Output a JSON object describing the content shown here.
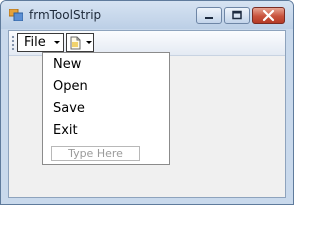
{
  "window": {
    "title": "frmToolStrip",
    "icons": {
      "app": "form-icon",
      "minimize": "minimize-icon",
      "maximize": "maximize-icon",
      "close": "close-icon"
    }
  },
  "toolstrip": {
    "file_menu": {
      "label": "File",
      "icon": "chevron-down-icon"
    },
    "new_item_split": {
      "icon": "new-document-icon",
      "arrow": "chevron-down-icon"
    }
  },
  "file_dropdown": {
    "items": [
      {
        "label": "New"
      },
      {
        "label": "Open"
      },
      {
        "label": "Save"
      },
      {
        "label": "Exit"
      }
    ],
    "type_here": "Type Here"
  },
  "colors": {
    "title_bar": "#c9d9ec",
    "close_button": "#c8533d",
    "client_area": "#f0f0f0",
    "menu_background": "#ffffff"
  }
}
